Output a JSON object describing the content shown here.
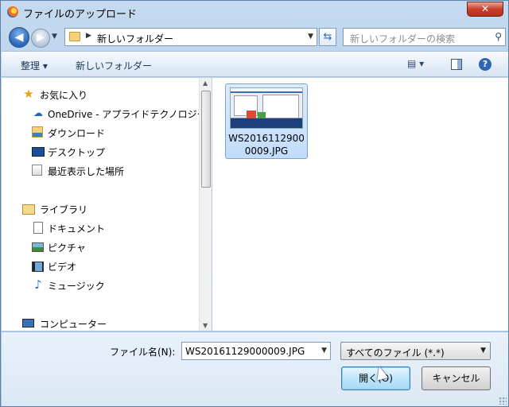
{
  "window": {
    "title": "ファイルのアップロード",
    "close_label": "✕"
  },
  "navbar": {
    "back_icon": "◀",
    "forward_icon": "▶",
    "history_icon": "▼",
    "address_sep": "▶",
    "address_text": "新しいフォルダー",
    "address_dropdown": "▼",
    "refresh_icon": "⇆",
    "search_placeholder": "新しいフォルダーの検索",
    "search_icon": "⚲"
  },
  "toolbar": {
    "organize_label": "整理 ▾",
    "new_folder_label": "新しいフォルダー",
    "view_icon": "▤ ▾",
    "help_icon": "?"
  },
  "nav_pane": {
    "favorites": {
      "label": "お気に入り",
      "icon": "★"
    },
    "onedrive": {
      "label": "OneDrive - アプライドテクノロジー",
      "icon": "☁"
    },
    "downloads": {
      "label": "ダウンロード"
    },
    "desktop": {
      "label": "デスクトップ"
    },
    "recent": {
      "label": "最近表示した場所"
    },
    "libraries": {
      "label": "ライブラリ"
    },
    "documents": {
      "label": "ドキュメント"
    },
    "pictures": {
      "label": "ピクチャ"
    },
    "videos": {
      "label": "ビデオ"
    },
    "music": {
      "label": "ミュージック",
      "icon": "♪"
    },
    "computer": {
      "label": "コンピューター"
    },
    "scroll_up": "▲",
    "scroll_down": "▼"
  },
  "content": {
    "file": {
      "name": "WS20161129000009.JPG"
    }
  },
  "bottom": {
    "filename_label": "ファイル名(N):",
    "filename_value": "WS20161129000009.JPG",
    "filename_dropdown": "▼",
    "filetype_value": "すべてのファイル (*.*)",
    "filetype_dropdown": "▼",
    "open_label": "開く(O)",
    "cancel_label": "キャンセル"
  }
}
